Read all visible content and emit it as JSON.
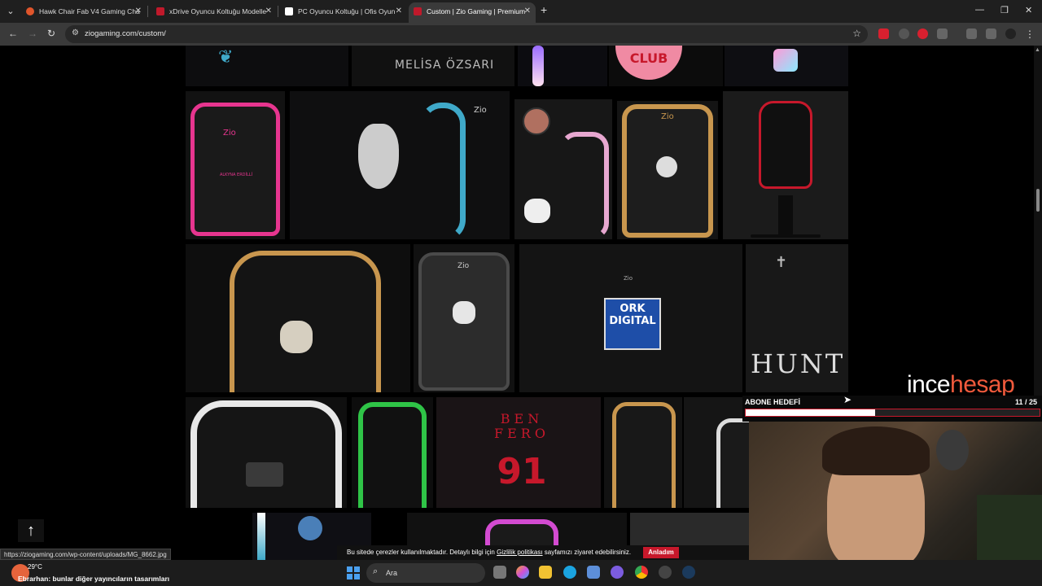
{
  "browser": {
    "tabs": [
      {
        "title": "Hawk Chair Fab V4 Gaming Cha",
        "color": "#e0552b",
        "active": false
      },
      {
        "title": "xDrive Oyuncu Koltuğu Modelle",
        "color": "#c0192b",
        "active": false
      },
      {
        "title": "PC Oyuncu Koltuğu | Ofis Oyun",
        "color": "#ffffff",
        "active": false
      },
      {
        "title": "Custom | Zio Gaming | Premium",
        "color": "#c0192b",
        "active": true
      }
    ],
    "new_tab": "+",
    "url": "ziogaming.com/custom/"
  },
  "gallery": {
    "melisa_text": "MELİSA ÖZSARI",
    "club_text": "CLUB",
    "alkyna_text": "ALKYNA ERDİLLİ",
    "ork_text": "ORK\nDIGITAL",
    "hunt_text": "HUNT",
    "benfero_text": "BEN\nFERO",
    "number_text": "91",
    "zio_text": "Zio"
  },
  "back_to_top": "↑",
  "cookie": {
    "text_before": "Bu sitede çerezler kullanılmaktadır. Detaylı bilgi için ",
    "link": "Gizlilik politikası",
    "text_after": " sayfamızı ziyaret edebilirsiniz.",
    "button": "Anladım"
  },
  "status_url": "https://ziogaming.com/wp-content/uploads/MG_8662.jpg",
  "taskbar": {
    "temperature": "29°C",
    "chat_message": "Ebrarhan: bunlar diğer yayıncıların tasarımları",
    "search_placeholder": "Ara"
  },
  "stream_overlay": {
    "logo_part1": "ince",
    "logo_part2": "hesap",
    "goal_title": "ABONE HEDEFİ",
    "goal_count": "11 / 25",
    "goal_progress": 0.44
  },
  "colors": {
    "accent_red": "#c7182b",
    "pink": "#e7358f",
    "teal": "#3fa9c9",
    "gold": "#c8964e",
    "green": "#2fc447"
  }
}
